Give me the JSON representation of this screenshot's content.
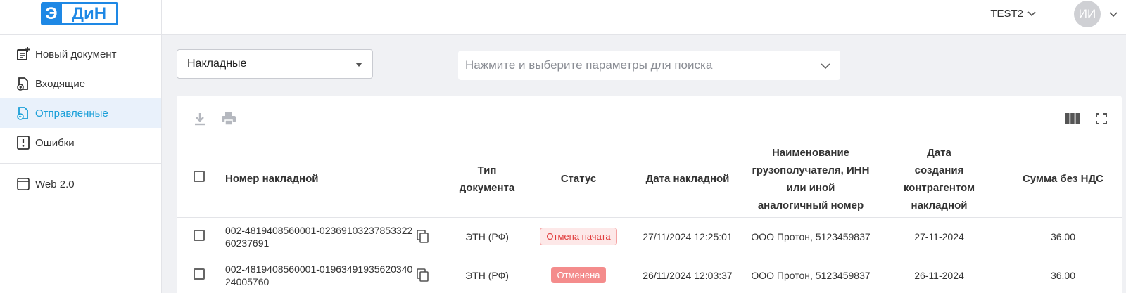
{
  "logo": {
    "letter": "Э",
    "text": "ДиН"
  },
  "sidebar": {
    "items": [
      {
        "label": "Новый документ",
        "icon": "new-document-icon"
      },
      {
        "label": "Входящие",
        "icon": "incoming-icon"
      },
      {
        "label": "Отправленные",
        "icon": "sent-icon",
        "active": true
      },
      {
        "label": "Ошибки",
        "icon": "errors-icon"
      }
    ],
    "extra": {
      "label": "Web 2.0",
      "icon": "web-icon"
    }
  },
  "topbar": {
    "org": "TEST2",
    "avatar_initials": "ИИ"
  },
  "filters": {
    "doc_type": "Накладные",
    "search_placeholder": "Нажмите и выберите параметры для поиска"
  },
  "toolbar": {
    "download_icon": "download-icon",
    "print_icon": "print-icon",
    "columns_icon": "columns-icon",
    "fullscreen_icon": "fullscreen-icon"
  },
  "table": {
    "columns": {
      "number": "Номер накладной",
      "doc_type": "Тип документа",
      "status": "Статус",
      "date": "Дата накладной",
      "consignee": "Наименование грузополучателя, ИНН или иной аналогичный номер",
      "created": "Дата создания контрагентом накладной",
      "sum": "Сумма без НДС"
    },
    "rows": [
      {
        "number_line1": "002-4819408560001-02369103237853322",
        "number_line2": "60237691",
        "doc_type": "ЭТН (РФ)",
        "status": "Отмена начата",
        "date": "27/11/2024 12:25:01",
        "consignee": "ООО Протон, 5123459837",
        "created": "27-11-2024",
        "sum": "36.00"
      },
      {
        "number_line1": "002-4819408560001-01963491935620340",
        "number_line2": "24005760",
        "doc_type": "ЭТН (РФ)",
        "status": "Отменена",
        "date": "26/11/2024 12:03:37",
        "consignee": "ООО Протон, 5123459837",
        "created": "26-11-2024",
        "sum": "36.00"
      }
    ]
  },
  "colors": {
    "accent": "#1e88e5",
    "active_text": "#1a9fd8",
    "status_started": "#e03b3b",
    "status_cancelled": "#f48c8c"
  }
}
